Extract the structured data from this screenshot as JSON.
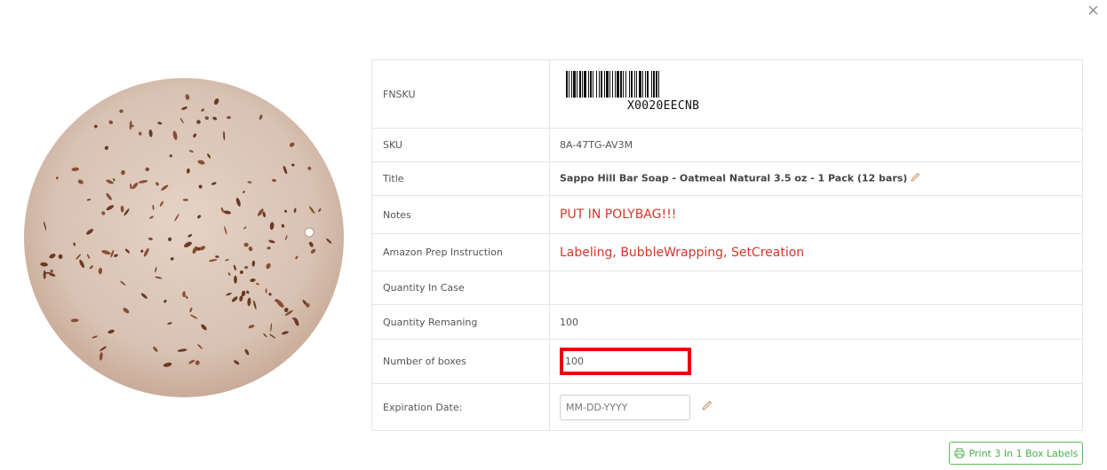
{
  "fields": {
    "fnsku": {
      "label": "FNSKU",
      "barcode_value": "X0020EECNB"
    },
    "sku": {
      "label": "SKU",
      "value": "8A-47TG-AV3M"
    },
    "title": {
      "label": "Title",
      "value": "Sappo Hill Bar Soap - Oatmeal Natural 3.5 oz - 1 Pack (12 bars)"
    },
    "notes": {
      "label": "Notes",
      "value": "PUT IN POLYBAG!!!"
    },
    "prep": {
      "label": "Amazon Prep Instruction",
      "value": "Labeling, BubbleWrapping, SetCreation"
    },
    "qty_in_case": {
      "label": "Quantity In Case",
      "value": ""
    },
    "qty_remaining": {
      "label": "Quantity Remaning",
      "value": "100"
    },
    "num_boxes": {
      "label": "Number of boxes",
      "value": "100"
    },
    "expiration": {
      "label": "Expiration Date:",
      "placeholder": "MM-DD-YYYY"
    }
  },
  "actions": {
    "print_label": "Print 3 In 1 Box Labels"
  },
  "icons": {
    "close": "close-icon",
    "edit": "pencil-icon",
    "print": "printer-icon"
  },
  "colors": {
    "notes_red": "#d9342b",
    "highlight_red": "#e8000c",
    "button_green": "#5cb85c",
    "pencil_orange": "#c8956a"
  }
}
